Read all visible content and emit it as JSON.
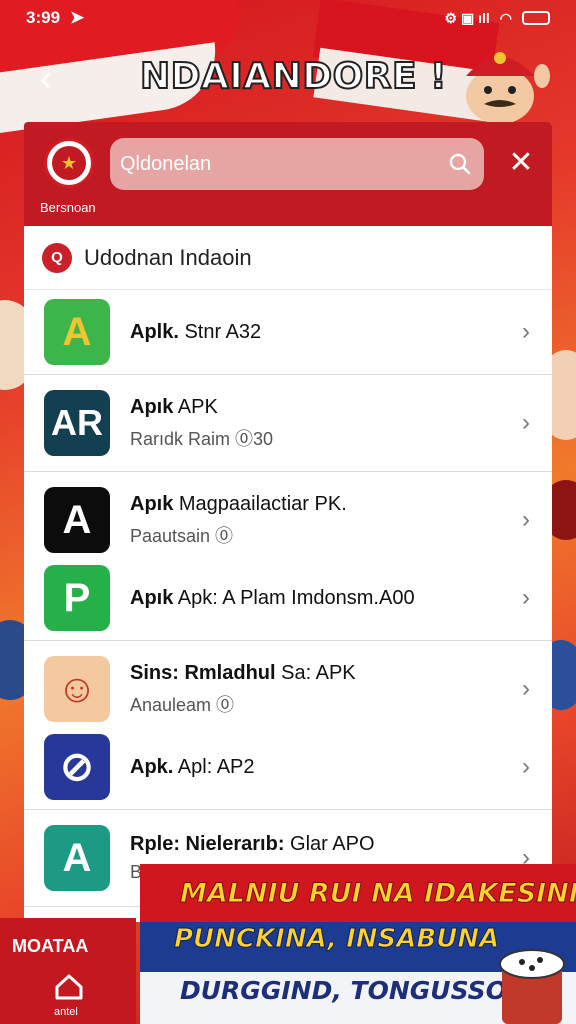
{
  "status_bar": {
    "time": "3:99",
    "icons": "⚙ ▣ ıll"
  },
  "header": {
    "back": "‹",
    "title": "NDAIANDORE !"
  },
  "search": {
    "badge_label": "Bersnoan",
    "value": "Qldonelan",
    "close": "✕"
  },
  "section": {
    "icon": "Q",
    "title": "Udodnan Indaoin"
  },
  "groups": [
    {
      "items": [
        {
          "icon_text": "A",
          "icon_color": "#3cb54a",
          "name_bold": "Aplk.",
          "name_rest": " Stnr A32",
          "sub": ""
        }
      ]
    },
    {
      "items": [
        {
          "icon_text": "AR",
          "icon_color": "#134050",
          "name_bold": "Apık",
          "name_rest": " APK",
          "sub": "Rarıdk Raim ⓪30"
        }
      ]
    },
    {
      "items": [
        {
          "icon_text": "A",
          "icon_color": "#0c0c0c",
          "name_bold": "Apık",
          "name_rest": " Magpaailactiar PK.",
          "sub": "Paautsain ⓪"
        },
        {
          "icon_text": "P",
          "icon_color": "#26b04a",
          "name_bold": "Apık",
          "name_rest": " Apk: A Plam Imdonsm.A00",
          "sub": ""
        }
      ]
    },
    {
      "items": [
        {
          "icon_text": "☺",
          "icon_color": "#f4c9a0",
          "name_bold": "Sins: Rmladhul",
          "name_rest": " Sa: APK",
          "sub": "Anauleam ⓪"
        },
        {
          "icon_text": "⊘",
          "icon_color": "#27389a",
          "name_bold": "Apk.",
          "name_rest": " Apl: AP2",
          "sub": ""
        }
      ]
    },
    {
      "items": [
        {
          "icon_text": "A",
          "icon_color": "#1c9a84",
          "name_bold": "Rple: Nielerarıb:",
          "name_rest": " Glar APO",
          "sub": "Bucuserauh:"
        }
      ]
    }
  ],
  "bottom_nav": {
    "label": "MOATAA",
    "sub": "antel"
  },
  "promo": {
    "line1": "MALNIU RUI NA IDAKESINI",
    "line2": "PUNCKINA, INSABUNA",
    "line3": "DURGGIND, TONGUSSOG"
  },
  "colors": {
    "primary_red": "#c11a23",
    "accent_yellow": "#ffd22c",
    "navy": "#1d3b91"
  }
}
